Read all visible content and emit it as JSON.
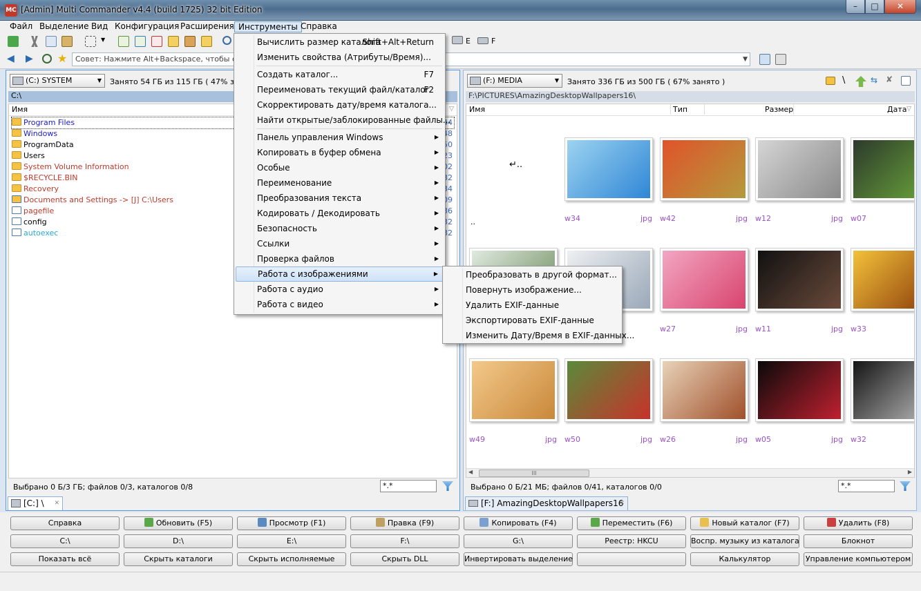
{
  "window": {
    "title": "[Admin] Multi Commander v4.4 (build 1725) 32 bit Edition",
    "app_icon": "MC"
  },
  "menubar": [
    "Файл",
    "Выделение",
    "Вид",
    "Конфигурация",
    "Расширения",
    "Инструменты",
    "Справка"
  ],
  "toolbar": {
    "drive_e": "E",
    "drive_f": "F",
    "tip": "Совет: Нажмите Alt+Backspace, чтобы отк"
  },
  "left_panel": {
    "drive": "(C:) SYSTEM",
    "usage": "Занято 54 ГБ из 115 ГБ ( 47% занят",
    "path": "C:\\",
    "col_name": "Имя",
    "files": [
      {
        "name": "Program Files",
        "color": "#1a1acf",
        "type": "folder",
        "side": "44"
      },
      {
        "name": "Windows",
        "color": "#1a1acf",
        "type": "folder",
        "side": "48"
      },
      {
        "name": "ProgramData",
        "color": "#000000",
        "type": "folder",
        "side": "50"
      },
      {
        "name": "Users",
        "color": "#000000",
        "type": "folder",
        "side": "23"
      },
      {
        "name": "System Volume Information",
        "color": "#c0392b",
        "type": "folder",
        "side": "02"
      },
      {
        "name": "$RECYCLE.BIN",
        "color": "#c0392b",
        "type": "folder",
        "side": "32"
      },
      {
        "name": "Recovery",
        "color": "#c0392b",
        "type": "folder",
        "side": "34"
      },
      {
        "name": "Documents and Settings ->  [J] C:\\Users",
        "color": "#c0392b",
        "type": "link",
        "side": "09"
      },
      {
        "name": "pagefile",
        "color": "#c0392b",
        "type": "doc",
        "side": "36"
      },
      {
        "name": "config",
        "color": "#000000",
        "type": "doc",
        "side": "32"
      },
      {
        "name": "autoexec",
        "color": "#2aa7d6",
        "type": "doc",
        "side": "32"
      }
    ],
    "status": "Выбрано 0 Б/3 ГБ; файлов 0/3, каталогов 0/8",
    "filter": "*.*",
    "tab": "[C:] \\"
  },
  "right_panel": {
    "drive": "(F:) MEDIA",
    "usage": "Занято 336 ГБ из 500 ГБ ( 67% занято )",
    "path": "F:\\PICTURES\\AmazingDesktopWallpapers16\\",
    "cols": [
      "Имя",
      "Тип",
      "Размер",
      "Дата"
    ],
    "up_label": "..",
    "thumbs": [
      {
        "name": "w34",
        "ext": "jpg",
        "c1": "#9cd3f0",
        "c2": "#2f86d6"
      },
      {
        "name": "w42",
        "ext": "jpg",
        "c1": "#e0532a",
        "c2": "#b49a3c"
      },
      {
        "name": "w12",
        "ext": "jpg",
        "c1": "#d5d5d5",
        "c2": "#8a8a8a"
      },
      {
        "name": "w07",
        "ext": "jpg",
        "c1": "#2c3a2c",
        "c2": "#6ca83a"
      },
      {
        "name": "",
        "ext": "",
        "c1": "#dfeadf",
        "c2": "#6b8a5a"
      },
      {
        "name": "",
        "ext": "",
        "c1": "#eef0f2",
        "c2": "#9aa8b8"
      },
      {
        "name": "w27",
        "ext": "jpg",
        "c1": "#f2a6c2",
        "c2": "#d9446e"
      },
      {
        "name": "w11",
        "ext": "jpg",
        "c1": "#111111",
        "c2": "#6a4a3a"
      },
      {
        "name": "w33",
        "ext": "jpg",
        "c1": "#f3c23a",
        "c2": "#8a3a0a"
      },
      {
        "name": "w49",
        "ext": "jpg",
        "c1": "#f3c98a",
        "c2": "#c9883a"
      },
      {
        "name": "w50",
        "ext": "jpg",
        "c1": "#5a8a3a",
        "c2": "#c8322a"
      },
      {
        "name": "w26",
        "ext": "jpg",
        "c1": "#e8d2b8",
        "c2": "#a0502a"
      },
      {
        "name": "w05",
        "ext": "jpg",
        "c1": "#0a0a0a",
        "c2": "#c02030"
      },
      {
        "name": "w32",
        "ext": "jpg",
        "c1": "#151515",
        "c2": "#bbbbbb"
      }
    ],
    "hscroll": "III",
    "status": "Выбрано 0 Б/21 МБ; файлов 0/41, каталогов 0/0",
    "filter": "*.*",
    "tab": "[F:] AmazingDesktopWallpapers16"
  },
  "tools_menu": {
    "items": [
      {
        "label": "Вычислить размер каталога",
        "shortcut": "Shift+Alt+Return"
      },
      {
        "label": "Изменить свойства (Атрибуты/Время)..."
      },
      {
        "label": "Создать каталог...",
        "shortcut": "F7"
      },
      {
        "label": "Переименовать текущий файл/каталог",
        "shortcut": "F2"
      },
      {
        "label": "Скорректировать дату/время каталога..."
      },
      {
        "label": "Найти открытые/заблокированные файлы..."
      },
      {
        "label": "Панель управления Windows",
        "sub": "▶"
      },
      {
        "label": "Копировать в буфер обмена",
        "sub": "▶"
      },
      {
        "label": "Особые",
        "sub": "▶"
      },
      {
        "label": "Переименование",
        "sub": "▶"
      },
      {
        "label": "Преобразования текста",
        "sub": "▶"
      },
      {
        "label": "Кодировать / Декодировать",
        "sub": "▶"
      },
      {
        "label": "Безопасность",
        "sub": "▶"
      },
      {
        "label": "Ссылки",
        "sub": "▶"
      },
      {
        "label": "Проверка файлов",
        "sub": "▶"
      },
      {
        "label": "Работа с изображениями",
        "sub": "▶"
      },
      {
        "label": "Работа с аудио",
        "sub": "▶"
      },
      {
        "label": "Работа с видео",
        "sub": "▶"
      }
    ]
  },
  "image_submenu": [
    "Преобразовать в другой формат...",
    "Повернуть изображение...",
    "Удалить EXIF-данные",
    "Экспортировать EXIF-данные",
    "Изменить Дату/Время в EXIF-данных..."
  ],
  "buttons": {
    "row1": [
      "Справка",
      "Обновить (F5)",
      "Просмотр (F1)",
      "Правка (F9)",
      "Копировать (F4)",
      "Переместить (F6)",
      "Новый каталог (F7)",
      "Удалить (F8)"
    ],
    "row2": [
      "C:\\",
      "D:\\",
      "E:\\",
      "F:\\",
      "G:\\",
      "Реестр: HKCU",
      "Воспр. музыку из каталога",
      "Блокнот"
    ],
    "row3": [
      "Показать всё",
      "Скрыть каталоги",
      "Скрыть исполняемые",
      "Скрыть DLL",
      "Инвертировать выделение",
      "",
      "Калькулятор",
      "Управление компьютером"
    ]
  }
}
